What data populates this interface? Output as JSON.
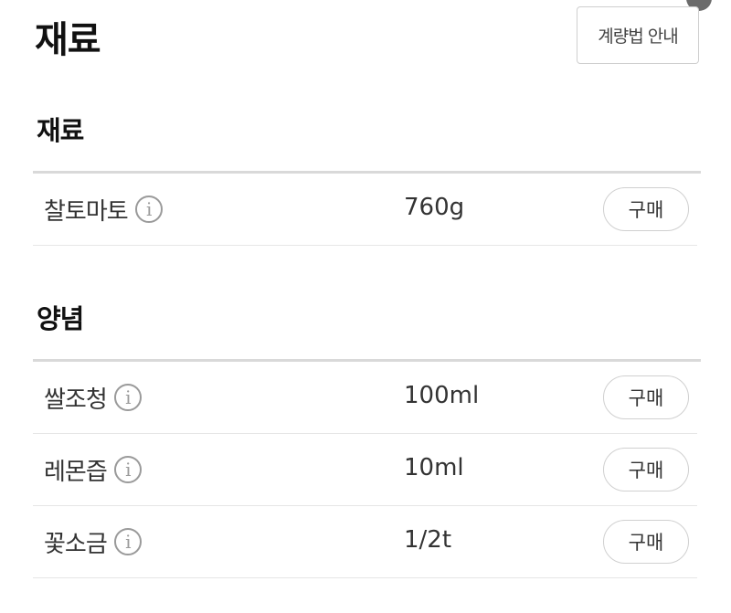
{
  "header": {
    "title": "재료",
    "guide_button_label": "계량법 안내"
  },
  "sections": [
    {
      "title": "재료",
      "items": [
        {
          "name": "찰토마토",
          "amount": "760g",
          "buy_label": "구매"
        }
      ]
    },
    {
      "title": "양념",
      "items": [
        {
          "name": "쌀조청",
          "amount": "100ml",
          "buy_label": "구매"
        },
        {
          "name": "레몬즙",
          "amount": "10ml",
          "buy_label": "구매"
        },
        {
          "name": "꽃소금",
          "amount": "1/2t",
          "buy_label": "구매"
        }
      ]
    }
  ],
  "icons": {
    "info": "info-icon"
  },
  "colors": {
    "divider": "#d9d9d9",
    "row_border": "#e6e6e6",
    "button_border": "#d0d0d0",
    "text": "#333333"
  }
}
